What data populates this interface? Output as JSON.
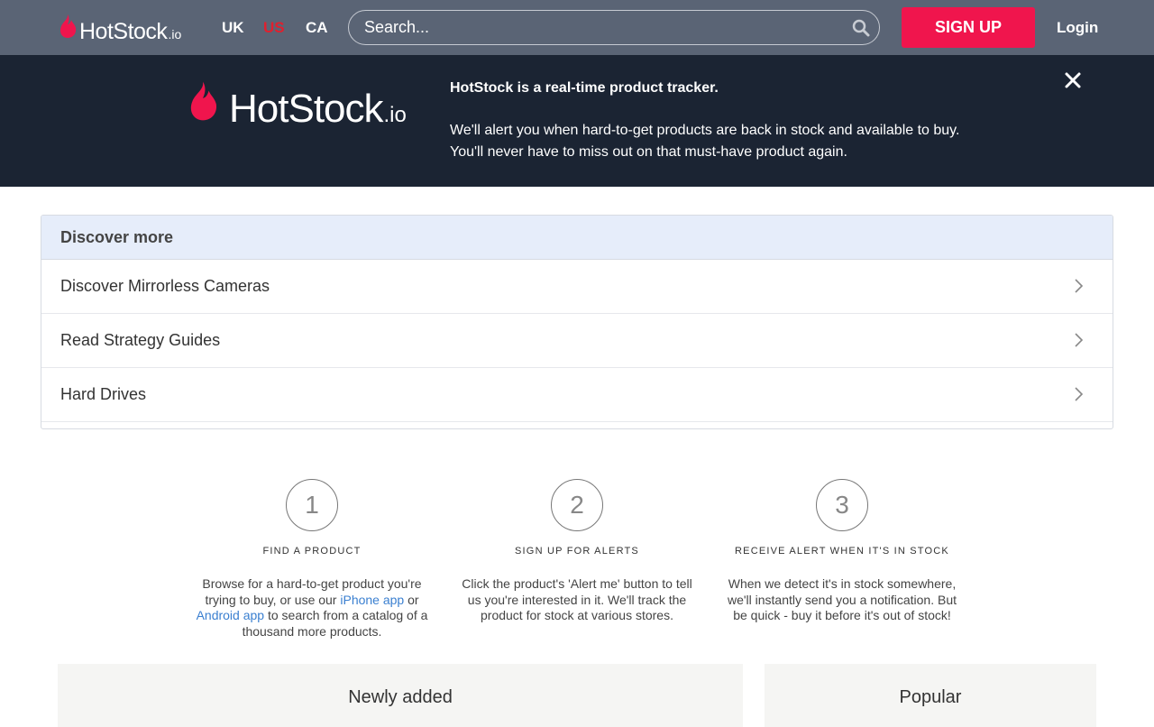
{
  "header": {
    "logo_word": "HotStock",
    "logo_tld": ".io",
    "regions": [
      {
        "label": "UK",
        "active": false
      },
      {
        "label": "US",
        "active": true
      },
      {
        "label": "CA",
        "active": false
      }
    ],
    "search_placeholder": "Search...",
    "signup_label": "SIGN UP",
    "login_label": "Login"
  },
  "banner": {
    "logo_word": "HotStock",
    "logo_tld": ".io",
    "title": "HotStock is a real-time product tracker.",
    "line1": "We'll alert you when hard-to-get products are back in stock and available to buy.",
    "line2": "You'll never have to miss out on that must-have product again."
  },
  "discover": {
    "title": "Discover more",
    "items": [
      {
        "label": "Discover Mirrorless Cameras"
      },
      {
        "label": "Read Strategy Guides"
      },
      {
        "label": "Hard Drives"
      }
    ]
  },
  "steps": [
    {
      "number": "1",
      "label": "FIND A PRODUCT",
      "text_a": "Browse for a hard-to-get product you're trying to buy, or use our ",
      "link1": "iPhone app",
      "text_b": " or ",
      "link2": "Android app",
      "text_c": " to search from a catalog of a thousand more products."
    },
    {
      "number": "2",
      "label": "SIGN UP FOR ALERTS",
      "text": "Click the product's 'Alert me' button to tell us you're interested in it. We'll track the product for stock at various stores."
    },
    {
      "number": "3",
      "label": "RECEIVE ALERT WHEN IT'S IN STOCK",
      "text": "When we detect it's in stock somewhere, we'll instantly send you a notification. But be quick - buy it before it's out of stock!"
    }
  ],
  "cards": {
    "newly_added": "Newly added",
    "popular": "Popular"
  },
  "colors": {
    "nav_bg": "#5a6475",
    "banner_bg": "#1b2433",
    "accent": "#f0154d",
    "active_region": "#e0202e",
    "link": "#3a7fd0"
  }
}
